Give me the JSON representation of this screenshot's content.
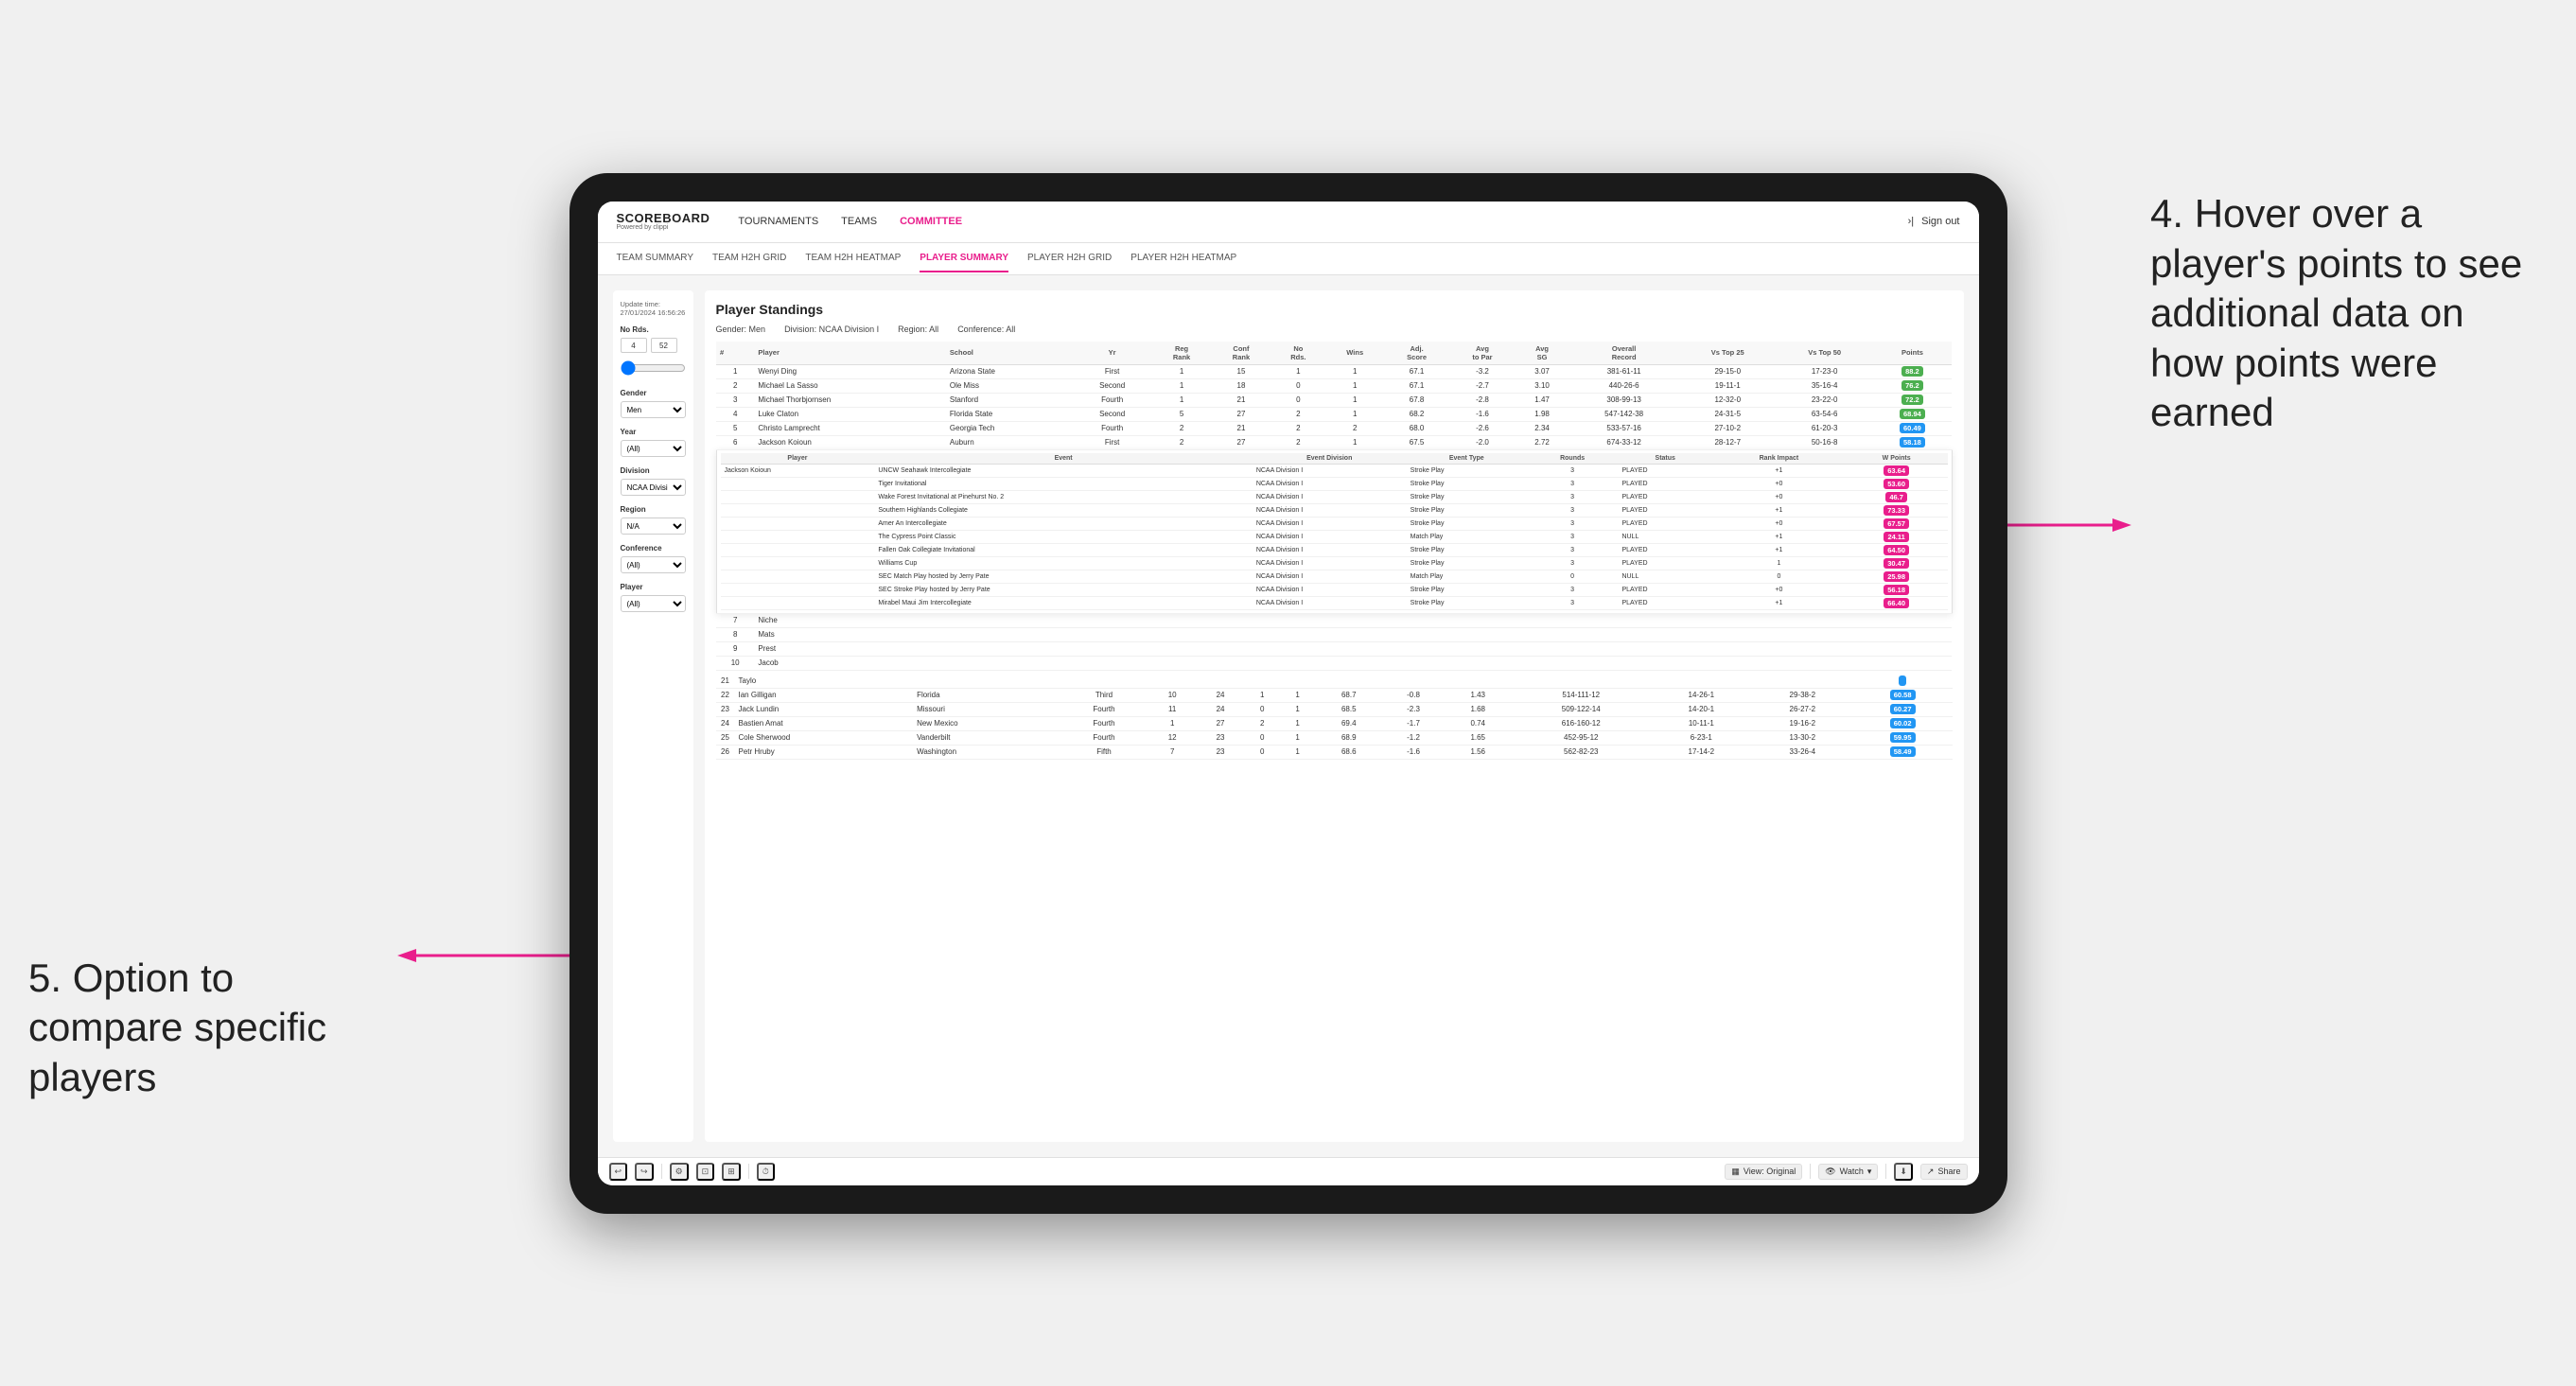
{
  "tablet": {
    "nav": {
      "logo": "SCOREBOARD",
      "logo_sub": "Powered by clippi",
      "items": [
        "TOURNAMENTS",
        "TEAMS",
        "COMMITTEE"
      ],
      "active_item": "COMMITTEE",
      "sign_out": "Sign out"
    },
    "sub_nav": {
      "items": [
        "TEAM SUMMARY",
        "TEAM H2H GRID",
        "TEAM H2H HEATMAP",
        "PLAYER SUMMARY",
        "PLAYER H2H GRID",
        "PLAYER H2H HEATMAP"
      ],
      "active_item": "PLAYER SUMMARY"
    },
    "filters": {
      "update_label": "Update time:",
      "update_time": "27/01/2024 16:56:26",
      "no_rds_label": "No Rds.",
      "rds_min": "4",
      "rds_max": "52",
      "gender_label": "Gender",
      "gender_value": "Men",
      "year_label": "Year",
      "year_value": "(All)",
      "division_label": "Division",
      "division_value": "NCAA Division I",
      "region_label": "Region",
      "region_value": "N/A",
      "conference_label": "Conference",
      "conference_value": "(All)",
      "player_label": "Player",
      "player_value": "(All)"
    },
    "standings": {
      "title": "Player Standings",
      "gender_label": "Gender:",
      "gender_value": "Men",
      "division_label": "Division:",
      "division_value": "NCAA Division I",
      "region_label": "Region:",
      "region_value": "All",
      "conference_label": "Conference:",
      "conference_value": "All",
      "columns": [
        "#",
        "Player",
        "School",
        "Yr",
        "Reg Rank",
        "Conf Rank",
        "No Rds.",
        "Wins",
        "Adj. Score",
        "Avg to Par",
        "Avg SG",
        "Overall Record",
        "Vs Top 25",
        "Vs Top 50",
        "Points"
      ],
      "rows": [
        {
          "rank": "1",
          "player": "Wenyi Ding",
          "school": "Arizona State",
          "yr": "First",
          "reg_rank": "1",
          "conf_rank": "15",
          "no_rds": "1",
          "wins": "1",
          "adj_score": "67.1",
          "avg_par": "-3.2",
          "avg_sg": "3.07",
          "record": "381-61-11",
          "vs25": "29-15-0",
          "vs50": "17-23-0",
          "points": "88.2",
          "points_color": "green"
        },
        {
          "rank": "2",
          "player": "Michael La Sasso",
          "school": "Ole Miss",
          "yr": "Second",
          "reg_rank": "1",
          "conf_rank": "18",
          "no_rds": "0",
          "wins": "1",
          "adj_score": "67.1",
          "avg_par": "-2.7",
          "avg_sg": "3.10",
          "record": "440-26-6",
          "vs25": "19-11-1",
          "vs50": "35-16-4",
          "points": "76.2",
          "points_color": "green"
        },
        {
          "rank": "3",
          "player": "Michael Thorbjornsen",
          "school": "Stanford",
          "yr": "Fourth",
          "reg_rank": "1",
          "conf_rank": "21",
          "no_rds": "0",
          "wins": "1",
          "adj_score": "67.8",
          "avg_par": "-2.8",
          "avg_sg": "1.47",
          "record": "308-99-13",
          "vs25": "12-32-0",
          "vs50": "23-22-0",
          "points": "72.2",
          "points_color": "green"
        },
        {
          "rank": "4",
          "player": "Luke Claton",
          "school": "Florida State",
          "yr": "Second",
          "reg_rank": "5",
          "conf_rank": "27",
          "no_rds": "2",
          "wins": "1",
          "adj_score": "68.2",
          "avg_par": "-1.6",
          "avg_sg": "1.98",
          "record": "547-142-38",
          "vs25": "24-31-5",
          "vs50": "63-54-6",
          "points": "68.94",
          "points_color": "green"
        },
        {
          "rank": "5",
          "player": "Christo Lamprecht",
          "school": "Georgia Tech",
          "yr": "Fourth",
          "reg_rank": "2",
          "conf_rank": "21",
          "no_rds": "2",
          "wins": "2",
          "adj_score": "68.0",
          "avg_par": "-2.6",
          "avg_sg": "2.34",
          "record": "533-57-16",
          "vs25": "27-10-2",
          "vs50": "61-20-3",
          "points": "60.49",
          "points_color": "blue"
        },
        {
          "rank": "6",
          "player": "Jackson Koioun",
          "school": "Auburn",
          "yr": "First",
          "reg_rank": "2",
          "conf_rank": "27",
          "no_rds": "2",
          "wins": "1",
          "adj_score": "67.5",
          "avg_par": "-2.0",
          "avg_sg": "2.72",
          "record": "674-33-12",
          "vs25": "28-12-7",
          "vs50": "50-16-8",
          "points": "58.18",
          "points_color": "blue"
        },
        {
          "rank": "7",
          "player": "Niche",
          "school": "",
          "yr": "",
          "reg_rank": "",
          "conf_rank": "",
          "no_rds": "",
          "wins": "",
          "adj_score": "",
          "avg_par": "",
          "avg_sg": "",
          "record": "",
          "vs25": "",
          "vs50": "",
          "points": ""
        },
        {
          "rank": "8",
          "player": "Mats",
          "school": "",
          "yr": "",
          "reg_rank": "",
          "conf_rank": "",
          "no_rds": "",
          "wins": "",
          "adj_score": "",
          "avg_par": "",
          "avg_sg": "",
          "record": "",
          "vs25": "",
          "vs50": "",
          "points": ""
        },
        {
          "rank": "9",
          "player": "Prest",
          "school": "",
          "yr": "",
          "reg_rank": "",
          "conf_rank": "",
          "no_rds": "",
          "wins": "",
          "adj_score": "",
          "avg_par": "",
          "avg_sg": "",
          "record": "",
          "vs25": "",
          "vs50": "",
          "points": ""
        },
        {
          "rank": "10",
          "player": "Jacob",
          "school": "",
          "yr": "",
          "reg_rank": "",
          "conf_rank": "",
          "no_rds": "",
          "wins": "",
          "adj_score": "",
          "avg_par": "",
          "avg_sg": "",
          "record": "",
          "vs25": "",
          "vs50": "",
          "points": ""
        }
      ],
      "tooltip_player": "Jackson Koioun",
      "tooltip_columns": [
        "Player",
        "Event",
        "Event Division",
        "Event Type",
        "Rounds",
        "Status",
        "Rank Impact",
        "W Points"
      ],
      "tooltip_rows": [
        {
          "player": "Jackson Koioun",
          "event": "UNCW Seahawk Intercollegiate",
          "division": "NCAA Division I",
          "type": "Stroke Play",
          "rounds": "3",
          "status": "PLAYED",
          "rank_impact": "+1",
          "points": "63.64"
        },
        {
          "player": "",
          "event": "Tiger Invitational",
          "division": "NCAA Division I",
          "type": "Stroke Play",
          "rounds": "3",
          "status": "PLAYED",
          "rank_impact": "+0",
          "points": "53.60"
        },
        {
          "player": "",
          "event": "Wake Forest Invitational at Pinehurst No. 2",
          "division": "NCAA Division I",
          "type": "Stroke Play",
          "rounds": "3",
          "status": "PLAYED",
          "rank_impact": "+0",
          "points": "46.7"
        },
        {
          "player": "",
          "event": "Southern Highlands Collegiate",
          "division": "NCAA Division I",
          "type": "Stroke Play",
          "rounds": "3",
          "status": "PLAYED",
          "rank_impact": "+1",
          "points": "73.33"
        },
        {
          "player": "",
          "event": "Amer An Intercollegiate",
          "division": "NCAA Division I",
          "type": "Stroke Play",
          "rounds": "3",
          "status": "PLAYED",
          "rank_impact": "+0",
          "points": "67.57"
        },
        {
          "player": "",
          "event": "The Cypress Point Classic",
          "division": "NCAA Division I",
          "type": "Match Play",
          "rounds": "3",
          "status": "NULL",
          "rank_impact": "+1",
          "points": "24.11"
        },
        {
          "player": "",
          "event": "Fallen Oak Collegiate Invitational",
          "division": "NCAA Division I",
          "type": "Stroke Play",
          "rounds": "3",
          "status": "PLAYED",
          "rank_impact": "+1",
          "points": "64.50"
        },
        {
          "player": "",
          "event": "Williams Cup",
          "division": "NCAA Division I",
          "type": "Stroke Play",
          "rounds": "3",
          "status": "PLAYED",
          "rank_impact": "1",
          "points": "30.47"
        },
        {
          "player": "",
          "event": "SEC Match Play hosted by Jerry Pate",
          "division": "NCAA Division I",
          "type": "Match Play",
          "rounds": "0",
          "status": "NULL",
          "rank_impact": "0",
          "points": "25.98"
        },
        {
          "player": "",
          "event": "SEC Stroke Play hosted by Jerry Pate",
          "division": "NCAA Division I",
          "type": "Stroke Play",
          "rounds": "3",
          "status": "PLAYED",
          "rank_impact": "+0",
          "points": "56.18"
        },
        {
          "player": "",
          "event": "Mirabel Maui Jim Intercollegiate",
          "division": "NCAA Division I",
          "type": "Stroke Play",
          "rounds": "3",
          "status": "PLAYED",
          "rank_impact": "+1",
          "points": "66.40"
        }
      ],
      "more_rows": [
        {
          "rank": "21",
          "player": "Taylo",
          "school": "",
          "yr": "",
          "reg_rank": "",
          "conf_rank": "",
          "no_rds": "",
          "wins": "",
          "adj_score": "",
          "avg_par": "",
          "avg_sg": "",
          "record": "",
          "vs25": "",
          "vs50": "",
          "points": ""
        },
        {
          "rank": "22",
          "player": "Ian Gilligan",
          "school": "Florida",
          "yr": "Third",
          "reg_rank": "10",
          "conf_rank": "24",
          "no_rds": "1",
          "wins": "1",
          "adj_score": "68.7",
          "avg_par": "-0.8",
          "avg_sg": "1.43",
          "record": "514-111-12",
          "vs25": "14-26-1",
          "vs50": "29-38-2",
          "points": "60.58"
        },
        {
          "rank": "23",
          "player": "Jack Lundin",
          "school": "Missouri",
          "yr": "Fourth",
          "reg_rank": "11",
          "conf_rank": "24",
          "no_rds": "0",
          "wins": "1",
          "adj_score": "68.5",
          "avg_par": "-2.3",
          "avg_sg": "1.68",
          "record": "509-122-14",
          "vs25": "14-20-1",
          "vs50": "26-27-2",
          "points": "60.27"
        },
        {
          "rank": "24",
          "player": "Bastien Amat",
          "school": "New Mexico",
          "yr": "Fourth",
          "reg_rank": "1",
          "conf_rank": "27",
          "no_rds": "2",
          "wins": "1",
          "adj_score": "69.4",
          "avg_par": "-1.7",
          "avg_sg": "0.74",
          "record": "616-160-12",
          "vs25": "10-11-1",
          "vs50": "19-16-2",
          "points": "60.02"
        },
        {
          "rank": "25",
          "player": "Cole Sherwood",
          "school": "Vanderbilt",
          "yr": "Fourth",
          "reg_rank": "12",
          "conf_rank": "23",
          "no_rds": "0",
          "wins": "1",
          "adj_score": "68.9",
          "avg_par": "-1.2",
          "avg_sg": "1.65",
          "record": "452-95-12",
          "vs25": "6-23-1",
          "vs50": "13-30-2",
          "points": "59.95"
        },
        {
          "rank": "26",
          "player": "Petr Hruby",
          "school": "Washington",
          "yr": "Fifth",
          "reg_rank": "7",
          "conf_rank": "23",
          "no_rds": "0",
          "wins": "1",
          "adj_score": "68.6",
          "avg_par": "-1.6",
          "avg_sg": "1.56",
          "record": "562-82-23",
          "vs25": "17-14-2",
          "vs50": "33-26-4",
          "points": "58.49"
        }
      ]
    },
    "toolbar": {
      "view_label": "View: Original",
      "watch_label": "Watch",
      "share_label": "Share"
    }
  },
  "annotations": {
    "right": "4. Hover over a\nplayer's points\nto see\nadditional data\non how points\nwere earned",
    "left": "5. Option to\ncompare\nspecific players"
  }
}
